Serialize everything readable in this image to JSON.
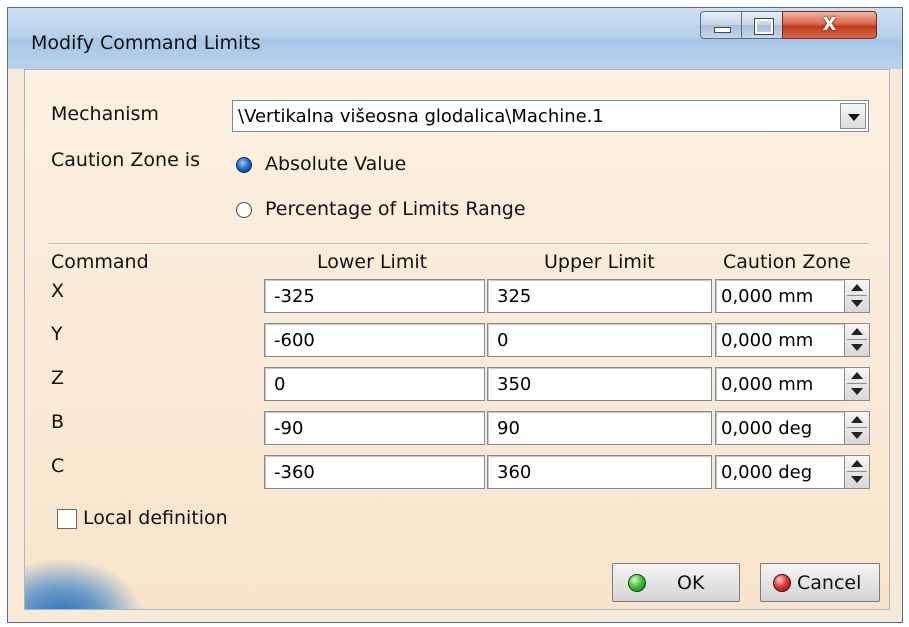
{
  "window": {
    "title": "Modify Command Limits"
  },
  "titlebar": {
    "minimize_glyph": "—",
    "maximize_glyph": "□",
    "close_glyph": "X"
  },
  "mechanism": {
    "label": "Mechanism",
    "value": "\\Vertikalna višeosna glodalica\\Machine.1"
  },
  "caution_zone": {
    "label": "Caution Zone is",
    "options": [
      {
        "label": "Absolute Value",
        "checked": true
      },
      {
        "label": "Percentage of Limits Range",
        "checked": false
      }
    ]
  },
  "table": {
    "headers": {
      "command": "Command",
      "lower": "Lower Limit",
      "upper": "Upper Limit",
      "caution": "Caution Zone"
    },
    "rows": [
      {
        "command": "X",
        "lower": "-325",
        "upper": "325",
        "caution": "0,000 mm"
      },
      {
        "command": "Y",
        "lower": "-600",
        "upper": "0",
        "caution": "0,000 mm"
      },
      {
        "command": "Z",
        "lower": "0",
        "upper": "350",
        "caution": "0,000 mm"
      },
      {
        "command": "B",
        "lower": "-90",
        "upper": "90",
        "caution": "0,000 deg"
      },
      {
        "command": "C",
        "lower": "-360",
        "upper": "360",
        "caution": "0,000 deg"
      }
    ]
  },
  "local_definition": {
    "label": "Local definition",
    "checked": false
  },
  "buttons": {
    "ok": "OK",
    "cancel": "Cancel"
  },
  "icons": {
    "ok": "green-dot-icon",
    "cancel": "red-dot-icon"
  }
}
